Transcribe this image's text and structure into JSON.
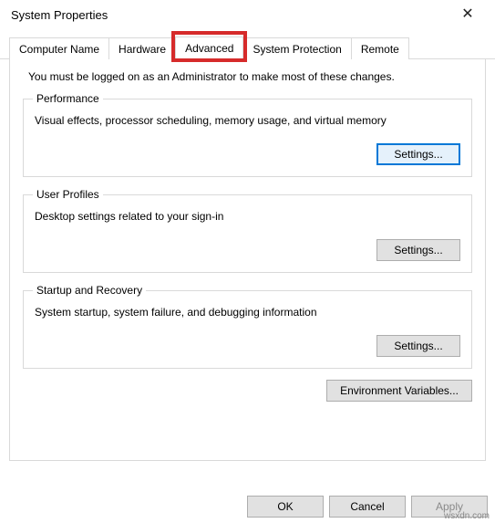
{
  "window": {
    "title": "System Properties",
    "close_glyph": "✕"
  },
  "tabs": {
    "items": [
      {
        "label": "Computer Name"
      },
      {
        "label": "Hardware"
      },
      {
        "label": "Advanced"
      },
      {
        "label": "System Protection"
      },
      {
        "label": "Remote"
      }
    ],
    "active_index": 2,
    "highlight_index": 2
  },
  "intro": "You must be logged on as an Administrator to make most of these changes.",
  "groups": {
    "performance": {
      "legend": "Performance",
      "desc": "Visual effects, processor scheduling, memory usage, and virtual memory",
      "button": "Settings..."
    },
    "user_profiles": {
      "legend": "User Profiles",
      "desc": "Desktop settings related to your sign-in",
      "button": "Settings..."
    },
    "startup_recovery": {
      "legend": "Startup and Recovery",
      "desc": "System startup, system failure, and debugging information",
      "button": "Settings..."
    }
  },
  "env_button": "Environment Variables...",
  "footer": {
    "ok": "OK",
    "cancel": "Cancel",
    "apply": "Apply"
  },
  "watermark": "wsxdn.com"
}
